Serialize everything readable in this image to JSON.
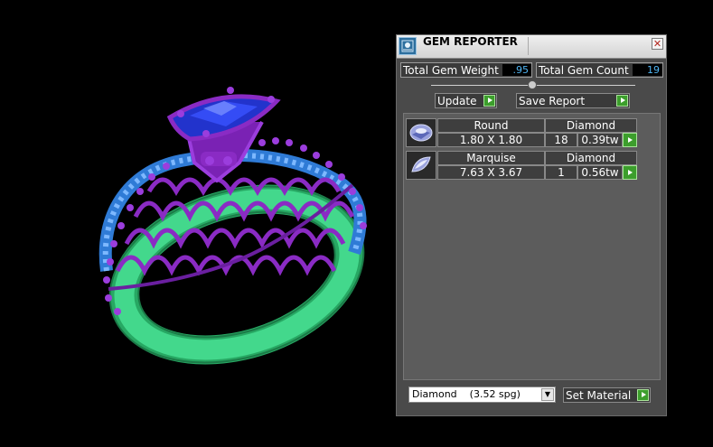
{
  "panel": {
    "title": "GEM REPORTER",
    "close": "✕",
    "total_weight": {
      "label": "Total Gem Weight",
      "value": ".95"
    },
    "total_count": {
      "label": "Total Gem Count",
      "value": "19"
    },
    "buttons": {
      "update": "Update",
      "save_report": "Save Report",
      "set_material": "Set Material"
    },
    "gems": [
      {
        "shape": "Round",
        "material": "Diamond",
        "size": "1.80 X 1.80",
        "count": "18",
        "weight": "0.39tw"
      },
      {
        "shape": "Marquise",
        "material": "Diamond",
        "size": "7.63 X 3.67",
        "count": "1",
        "weight": "0.56tw"
      }
    ],
    "material_select": {
      "value": "Diamond    (3.52 spg)"
    }
  },
  "colors": {
    "band": "#2fc37a",
    "prongs": "#8a2bc4",
    "center_stone": "#2233cc",
    "side_stones": "#5aa0ff",
    "accent_value": "#4fb4f2",
    "go_button": "#3c9e2c"
  },
  "icons": [
    "gem-reporter-icon",
    "close-icon",
    "play-arrow-icon",
    "round-gem-icon",
    "marquise-gem-icon",
    "dropdown-arrow-icon"
  ]
}
